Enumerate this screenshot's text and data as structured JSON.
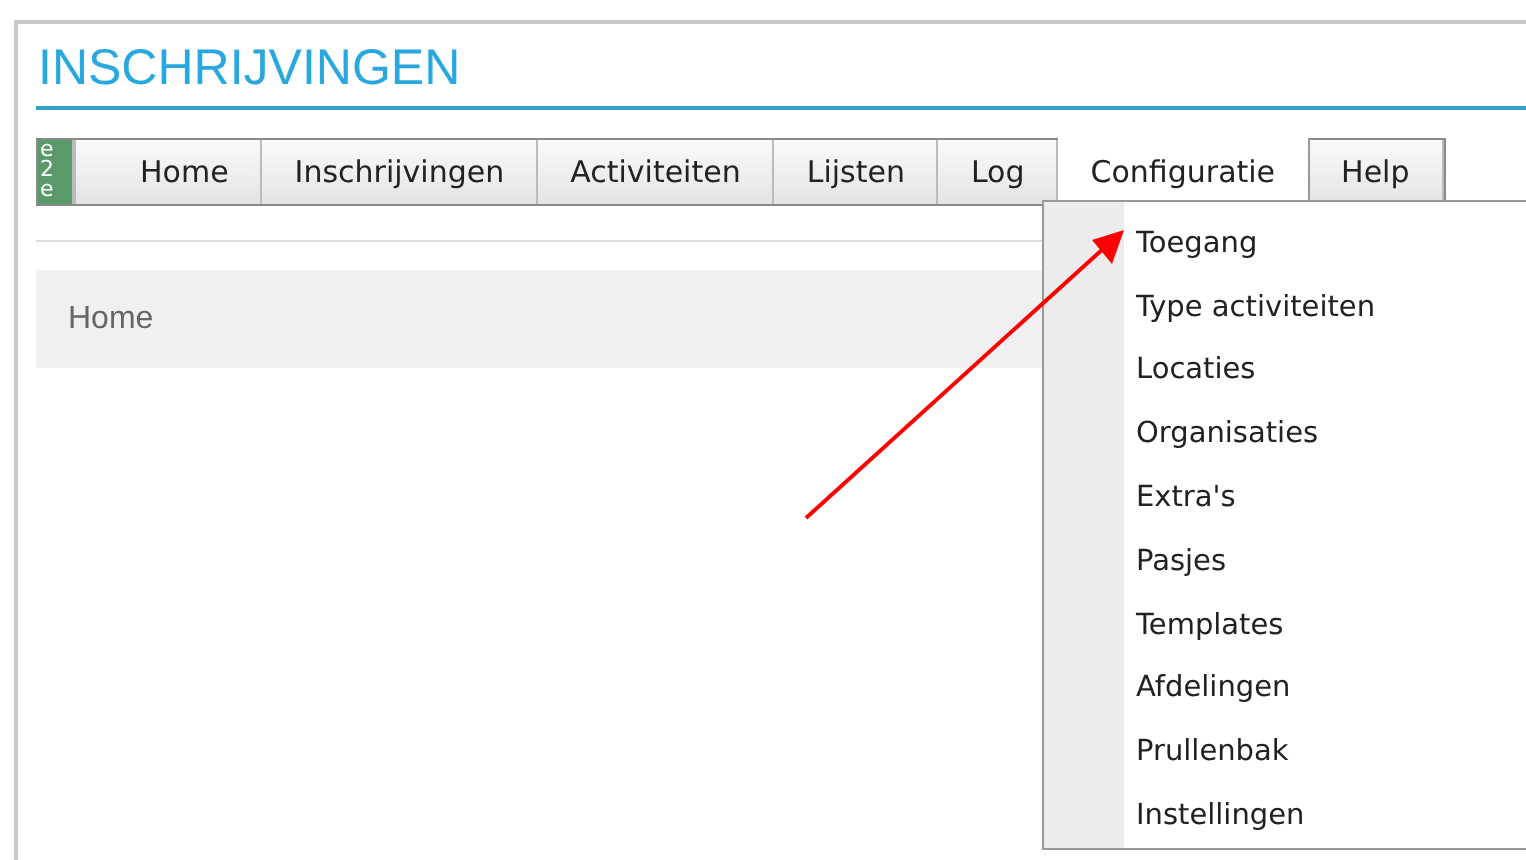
{
  "title": "INSCHRIJVINGEN",
  "menu": [
    {
      "label": "Home",
      "selected": false
    },
    {
      "label": "Inschrijvingen",
      "selected": false
    },
    {
      "label": "Activiteiten",
      "selected": false
    },
    {
      "label": "Lijsten",
      "selected": false
    },
    {
      "label": "Log",
      "selected": false
    },
    {
      "label": "Configuratie",
      "selected": true
    },
    {
      "label": "Help",
      "selected": false
    }
  ],
  "logo": {
    "letters": [
      "e",
      "2",
      "e"
    ]
  },
  "panel": {
    "heading": "Home"
  },
  "dropdown": [
    "Toegang",
    "Type activiteiten",
    "Locaties",
    "Organisaties",
    "Extra's",
    "Pasjes",
    "Templates",
    "Afdelingen",
    "Prullenbak",
    "Instellingen"
  ]
}
